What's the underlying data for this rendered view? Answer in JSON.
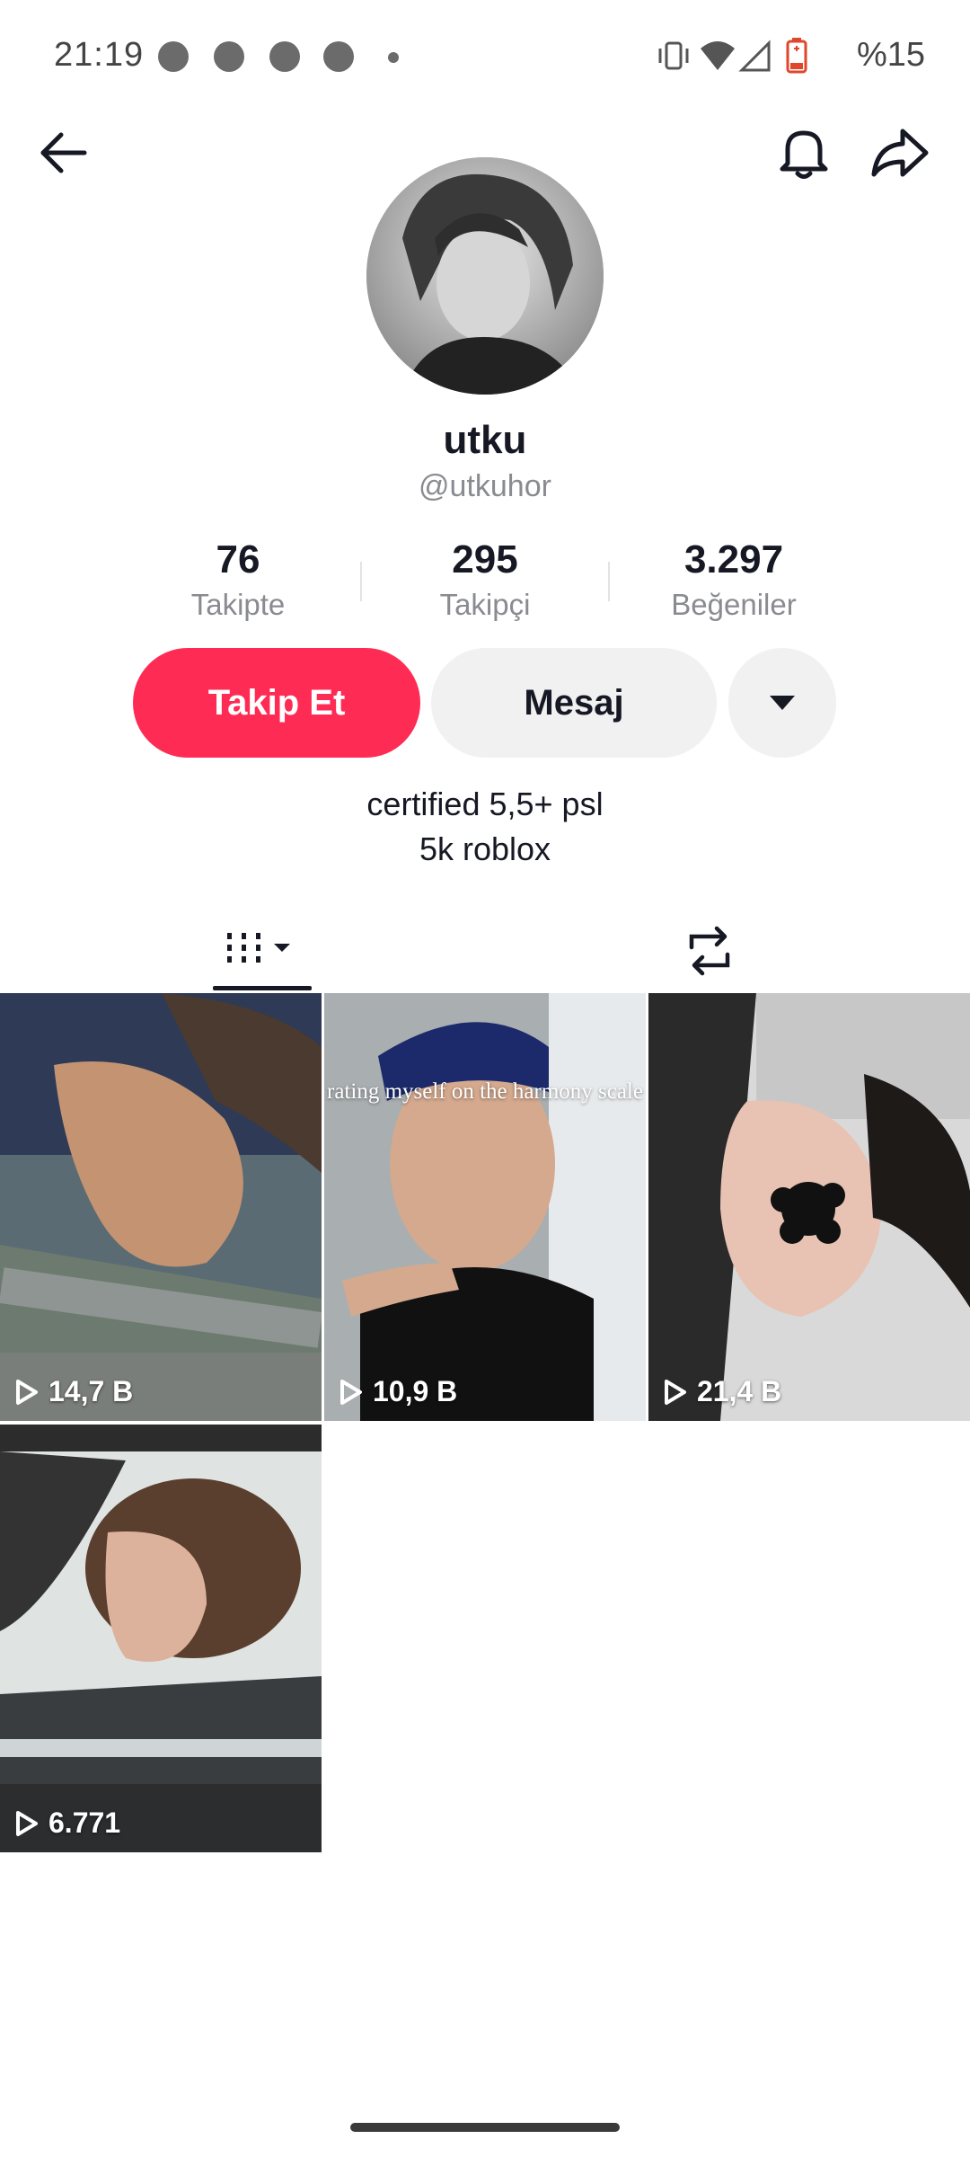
{
  "status_bar": {
    "time": "21:19",
    "battery_percent": "%15"
  },
  "header": {
    "back_icon": "back-arrow-icon",
    "bell_icon": "bell-icon",
    "share_icon": "share-icon"
  },
  "profile": {
    "display_name": "utku",
    "username": "@utkuhor",
    "stats": [
      {
        "value": "76",
        "label": "Takipte"
      },
      {
        "value": "295",
        "label": "Takipçi"
      },
      {
        "value": "3.297",
        "label": "Beğeniler"
      }
    ],
    "follow_label": "Takip Et",
    "message_label": "Mesaj",
    "bio_lines": [
      "certified 5,5+ psl",
      "5k roblox"
    ]
  },
  "tabs": {
    "videos_icon": "videos-grid-icon",
    "reposts_icon": "repost-icon"
  },
  "videos": [
    {
      "views": "14,7 B"
    },
    {
      "views": "10,9 B",
      "overlay": "rating myself on the harmony scale"
    },
    {
      "views": "21,4 B"
    },
    {
      "views": "6.771"
    }
  ],
  "colors": {
    "accent": "#fe2c55",
    "secondary_button": "#f1f1f2",
    "muted_text": "#8a8b91"
  }
}
